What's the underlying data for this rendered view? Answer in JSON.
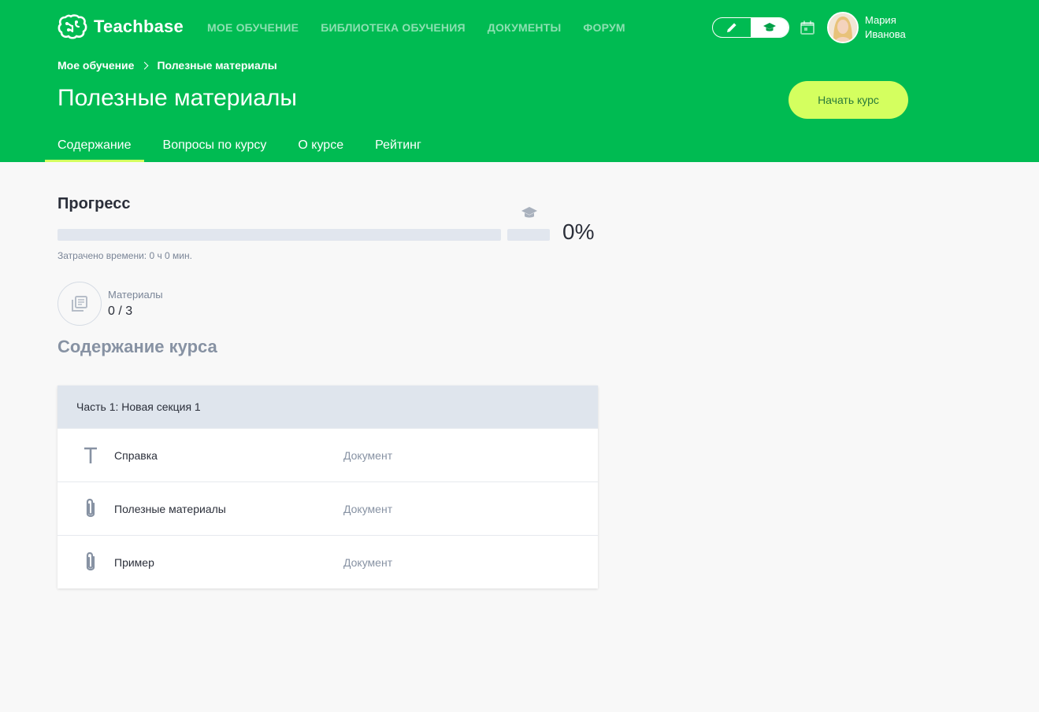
{
  "brand": {
    "name": "Teachbase"
  },
  "topnav": [
    {
      "label": "МОЕ ОБУЧЕНИЕ"
    },
    {
      "label": "БИБЛИОТЕКА ОБУЧЕНИЯ"
    },
    {
      "label": "ДОКУМЕНТЫ"
    },
    {
      "label": "ФОРУМ"
    }
  ],
  "user": {
    "first_name": "Мария",
    "last_name": "Иванова"
  },
  "breadcrumb": [
    "Мое обучение",
    "Полезные материалы"
  ],
  "page": {
    "title": "Полезные материалы",
    "start_button": "Начать курс"
  },
  "tabs": [
    {
      "label": "Содержание",
      "active": true
    },
    {
      "label": "Вопросы по курсу",
      "active": false
    },
    {
      "label": "О курсе",
      "active": false
    },
    {
      "label": "Рейтинг",
      "active": false
    }
  ],
  "progress": {
    "title": "Прогресс",
    "percent_text": "0%",
    "value": 0,
    "time_spent": "Затрачено времени: 0 ч 0 мин."
  },
  "materials": {
    "label": "Материалы",
    "count": "0 / 3"
  },
  "content": {
    "title": "Содержание курса",
    "section": "Часть 1: Новая секция 1",
    "lessons": [
      {
        "name": "Справка",
        "type": "Документ",
        "icon": "text-icon"
      },
      {
        "name": "Полезные материалы",
        "type": "Документ",
        "icon": "paperclip-icon"
      },
      {
        "name": "Пример",
        "type": "Документ",
        "icon": "paperclip-icon"
      }
    ]
  },
  "colors": {
    "primary": "#00bb52",
    "accent": "#d4ff5f",
    "muted": "#8792a3"
  }
}
